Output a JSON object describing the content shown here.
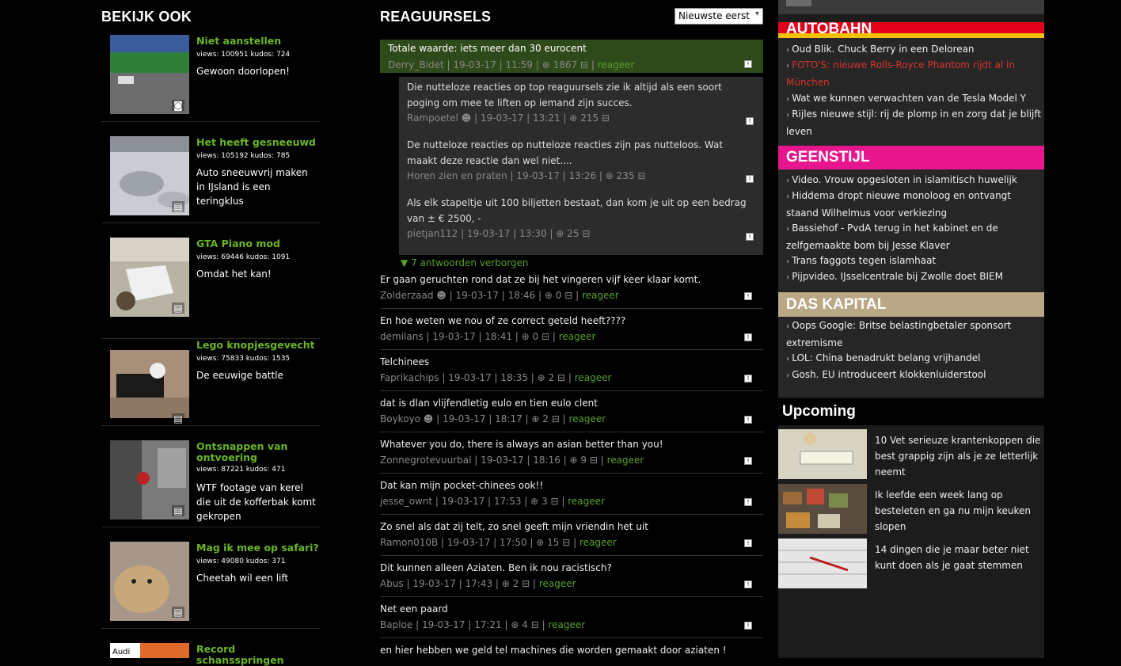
{
  "left": {
    "heading": "BEKIJK OOK",
    "videos": [
      {
        "title": "Niet aanstellen",
        "stats": "views: 100951 kudos: 724",
        "desc": "Gewoon doorlopen!",
        "icon": "camera-icon"
      },
      {
        "title": "Het heeft gesneeuwd",
        "stats": "views: 105192 kudos: 785",
        "desc": "Auto sneeuwvrij maken in IJsland is een teringklus",
        "icon": "film-icon"
      },
      {
        "title": "GTA Piano mod",
        "stats": "views: 69446 kudos: 1091",
        "desc": "Omdat het kan!",
        "icon": "film-icon"
      },
      {
        "title": "Lego knopjesgevecht",
        "stats": "views: 75833 kudos: 1535",
        "desc": "De eeuwige battle",
        "icon": "film-icon"
      },
      {
        "title": "Ontsnappen van ontvoering",
        "stats": "views: 87221 kudos: 471",
        "desc": "WTF footage van kerel die uit de kofferbak komt gekropen",
        "icon": "film-icon"
      },
      {
        "title": "Mag ik mee op safari?",
        "stats": "views: 49080 kudos: 371",
        "desc": "Cheetah wil een lift",
        "icon": "film-icon"
      },
      {
        "title": "Record schansspringen",
        "stats": "",
        "desc": "",
        "icon": ""
      }
    ]
  },
  "middle": {
    "heading": "REAGUURSELS",
    "sort": "Nieuwste eerst",
    "top": {
      "text": "Totale waarde: iets meer dan 30 eurocent",
      "user": "Derry_Bidet",
      "date": "19-03-17",
      "time": "11:59",
      "score": "1867",
      "action": "reageer"
    },
    "replies": [
      {
        "text": "Die nutteloze reacties op top reaguursels zie ik altijd als een soort poging om mee te liften op iemand zijn succes.",
        "user": "Rampoetel",
        "date": "19-03-17",
        "time": "13:21",
        "score": "215"
      },
      {
        "text": "De nutteloze reacties op nutteloze reacties zijn pas nutteloos. Wat maakt deze reactie dan wel niet....",
        "user": "Horen zien en praten",
        "date": "19-03-17",
        "time": "13:26",
        "score": "235"
      },
      {
        "text": "Als elk stapeltje uit 100 biljetten bestaat, dan kom je uit op een bedrag van ± € 2500, -",
        "user": "pietjan112",
        "date": "19-03-17",
        "time": "13:30",
        "score": "25"
      }
    ],
    "hidden": "7 antwoorden verborgen",
    "comments": [
      {
        "text": "Er gaan geruchten rond dat ze bij het vingeren vijf keer klaar komt.",
        "user": "Zolderzaad",
        "date": "19-03-17",
        "time": "18:46",
        "score": "0",
        "action": "reageer"
      },
      {
        "text": "En hoe weten we nou of ze correct geteld heeft????",
        "user": "demilans",
        "date": "19-03-17",
        "time": "18:41",
        "score": "0",
        "action": "reageer"
      },
      {
        "text": "Telchinees",
        "user": "Faprikachips",
        "date": "19-03-17",
        "time": "18:35",
        "score": "2",
        "action": "reageer"
      },
      {
        "text": "dat is dlan vlijfendletig eulo en tien eulo clent",
        "user": "Boykoyo",
        "date": "19-03-17",
        "time": "18:17",
        "score": "2",
        "action": "reageer"
      },
      {
        "text": "Whatever you do, there is always an asian better than you!",
        "user": "Zonnegrotevuurbal",
        "date": "19-03-17",
        "time": "18:16",
        "score": "9",
        "action": "reageer"
      },
      {
        "text": "Dat kan mijn pocket-chinees ook!!",
        "user": "jesse_ownt",
        "date": "19-03-17",
        "time": "17:53",
        "score": "3",
        "action": "reageer"
      },
      {
        "text": "Zo snel als dat zij telt, zo snel geeft mijn vriendin het uit",
        "user": "Ramon010B",
        "date": "19-03-17",
        "time": "17:50",
        "score": "15",
        "action": "reageer"
      },
      {
        "text": "Dit kunnen alleen Aziaten. Ben ik nou racistisch?",
        "user": "Abus",
        "date": "19-03-17",
        "time": "17:43",
        "score": "2",
        "action": "reageer"
      },
      {
        "text": "Net een paard",
        "user": "Baploe",
        "date": "19-03-17",
        "time": "17:21",
        "score": "4",
        "action": "reageer"
      },
      {
        "text": "en hier hebben we geld tel machines die worden gemaakt door aziaten !",
        "user": "",
        "date": "",
        "time": "",
        "score": "",
        "action": ""
      }
    ]
  },
  "right": {
    "autobahn": {
      "title": "AUTOBAHN",
      "items": [
        {
          "text": "Oud Blik. Chuck Berry in een Delorean",
          "highlight": false
        },
        {
          "text": "FOTO'S: nieuwe Rolls-Royce Phantom rijdt al in München",
          "highlight": true
        },
        {
          "text": "Wat we kunnen verwachten van de Tesla Model Y",
          "highlight": false
        },
        {
          "text": "Rijles nieuwe stijl: rij de plomp in en zorg dat je blijft leven",
          "highlight": false
        }
      ]
    },
    "geenstijl": {
      "title": "GEENSTIJL",
      "items": [
        {
          "text": "Video. Vrouw opgesloten in islamitisch huwelijk"
        },
        {
          "text": "Hiddema dropt nieuwe monoloog en ontvangt staand Wilhelmus voor verkiezing"
        },
        {
          "text": "Bassiehof - PvdA terug in het kabinet en de zelfgemaakte bom bij Jesse Klaver"
        },
        {
          "text": "Trans faggots tegen islamhaat"
        },
        {
          "text": "Pijpvideo. IJsselcentrale bij Zwolle doet BIEM"
        }
      ]
    },
    "daskapital": {
      "title": "DAS KAPITAL",
      "items": [
        {
          "text": "Oops Google: Britse belastingbetaler sponsort extremisme"
        },
        {
          "text": "LOL: China benadrukt belang vrijhandel"
        },
        {
          "text": "Gosh. EU introduceert klokkenluiderstool"
        }
      ]
    },
    "upcoming": {
      "title": "Upcoming",
      "items": [
        {
          "text": "10 Vet serieuze krantenkoppen die best grappig zijn als je ze letterlijk neemt"
        },
        {
          "text": "Ik leefde een week lang op besteleten en ga nu mijn keuken slopen"
        },
        {
          "text": "14 dingen die je maar beter niet kunt doen als je gaat stemmen"
        }
      ]
    }
  },
  "colors": {
    "green": "#6ab523",
    "autobahn_red": "#e3001b",
    "geenstijl_pink": "#e8168c",
    "daskapital_tan": "#b9a785"
  }
}
